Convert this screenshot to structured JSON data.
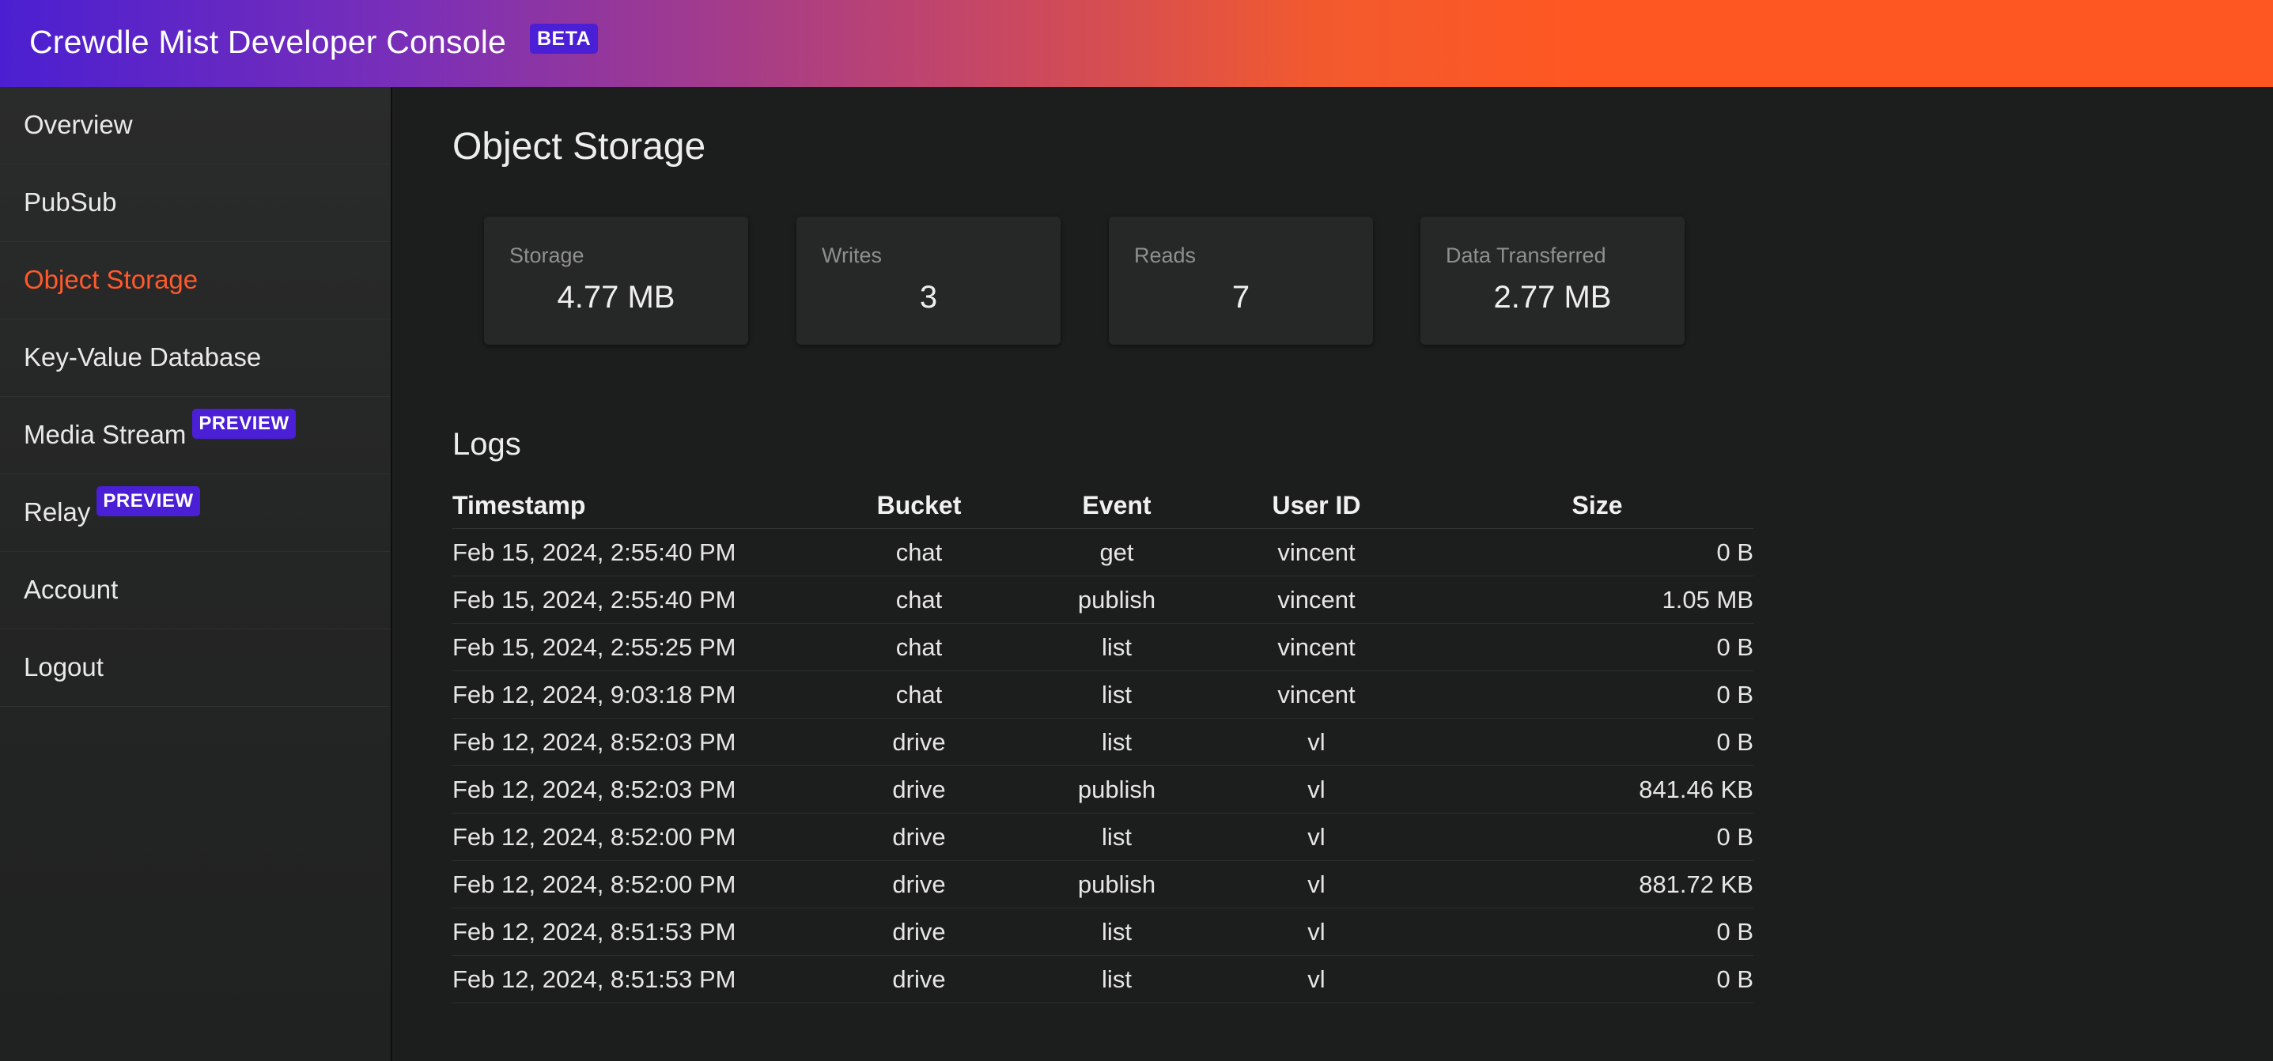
{
  "header": {
    "title": "Crewdle Mist Developer Console",
    "badge": "BETA"
  },
  "sidebar": {
    "items": [
      {
        "label": "Overview",
        "active": false,
        "badge": ""
      },
      {
        "label": "PubSub",
        "active": false,
        "badge": ""
      },
      {
        "label": "Object Storage",
        "active": true,
        "badge": ""
      },
      {
        "label": "Key-Value Database",
        "active": false,
        "badge": ""
      },
      {
        "label": "Media Stream",
        "active": false,
        "badge": "PREVIEW"
      },
      {
        "label": "Relay",
        "active": false,
        "badge": "PREVIEW"
      },
      {
        "label": "Account",
        "active": false,
        "badge": ""
      },
      {
        "label": "Logout",
        "active": false,
        "badge": ""
      }
    ]
  },
  "main": {
    "title": "Object Storage",
    "stats": [
      {
        "label": "Storage",
        "value": "4.77 MB"
      },
      {
        "label": "Writes",
        "value": "3"
      },
      {
        "label": "Reads",
        "value": "7"
      },
      {
        "label": "Data Transferred",
        "value": "2.77 MB"
      }
    ],
    "logs": {
      "title": "Logs",
      "columns": [
        "Timestamp",
        "Bucket",
        "Event",
        "User ID",
        "Size"
      ],
      "rows": [
        [
          "Feb 15, 2024, 2:55:40 PM",
          "chat",
          "get",
          "vincent",
          "0 B"
        ],
        [
          "Feb 15, 2024, 2:55:40 PM",
          "chat",
          "publish",
          "vincent",
          "1.05 MB"
        ],
        [
          "Feb 15, 2024, 2:55:25 PM",
          "chat",
          "list",
          "vincent",
          "0 B"
        ],
        [
          "Feb 12, 2024, 9:03:18 PM",
          "chat",
          "list",
          "vincent",
          "0 B"
        ],
        [
          "Feb 12, 2024, 8:52:03 PM",
          "drive",
          "list",
          "vl",
          "0 B"
        ],
        [
          "Feb 12, 2024, 8:52:03 PM",
          "drive",
          "publish",
          "vl",
          "841.46 KB"
        ],
        [
          "Feb 12, 2024, 8:52:00 PM",
          "drive",
          "list",
          "vl",
          "0 B"
        ],
        [
          "Feb 12, 2024, 8:52:00 PM",
          "drive",
          "publish",
          "vl",
          "881.72 KB"
        ],
        [
          "Feb 12, 2024, 8:51:53 PM",
          "drive",
          "list",
          "vl",
          "0 B"
        ],
        [
          "Feb 12, 2024, 8:51:53 PM",
          "drive",
          "list",
          "vl",
          "0 B"
        ]
      ]
    }
  },
  "colors": {
    "accent": "#ff5a2b",
    "badge": "#4a1fd6",
    "header_start": "#4b1fd1",
    "header_end": "#ff5722",
    "background": "#1c1d1d",
    "sidebar": "#262727"
  }
}
